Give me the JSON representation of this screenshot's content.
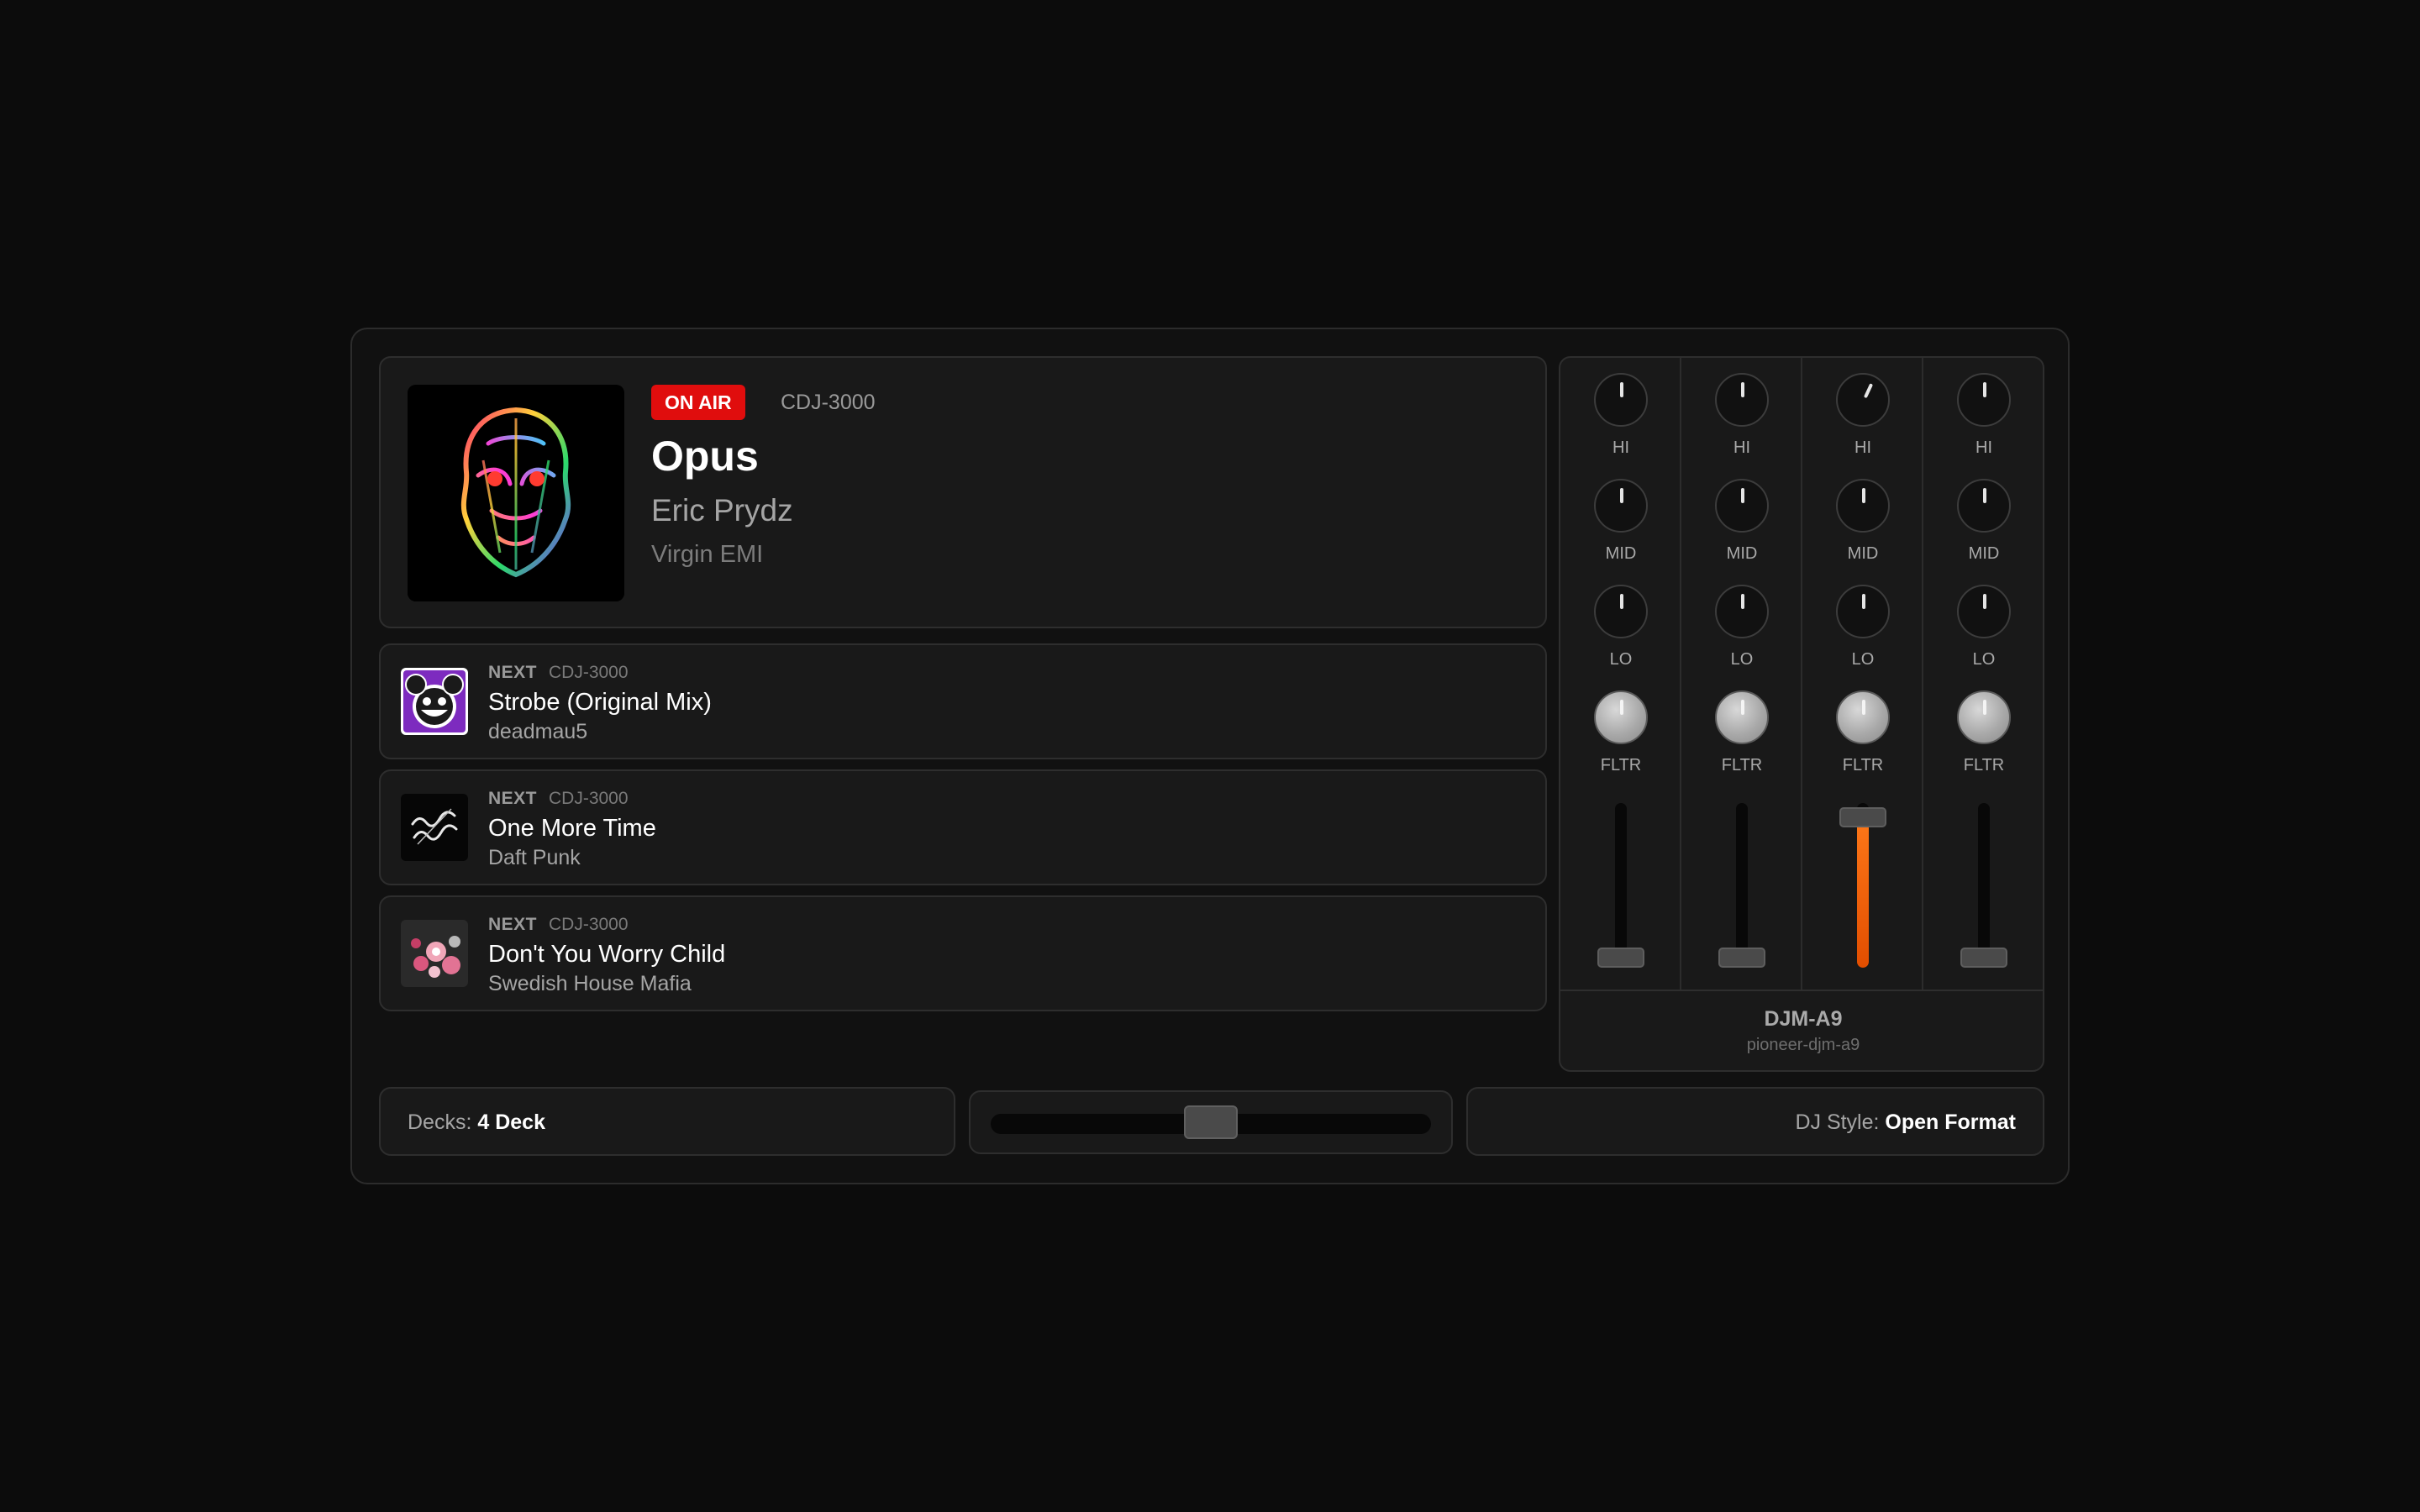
{
  "now_playing": {
    "badge": "ON AIR",
    "deck": "CDJ-3000",
    "title": "Opus",
    "artist": "Eric Prydz",
    "label": "Virgin EMI"
  },
  "queue": [
    {
      "tag": "NEXT",
      "deck": "CDJ-3000",
      "title": "Strobe (Original Mix)",
      "artist": "deadmau5"
    },
    {
      "tag": "NEXT",
      "deck": "CDJ-3000",
      "title": "One More Time",
      "artist": "Daft Punk"
    },
    {
      "tag": "NEXT",
      "deck": "CDJ-3000",
      "title": "Don't You Worry Child",
      "artist": "Swedish House Mafia"
    }
  ],
  "mixer": {
    "model": "DJM-A9",
    "id": "pioneer-djm-a9",
    "knob_labels": {
      "hi": "HI",
      "mid": "MID",
      "lo": "LO",
      "fltr": "FLTR"
    },
    "channels": [
      {
        "hi": 0,
        "mid": 0,
        "lo": 0,
        "fltr": 0,
        "fader": 0.0
      },
      {
        "hi": 0,
        "mid": 0,
        "lo": 0,
        "fltr": 0,
        "fader": 0.0
      },
      {
        "hi": 25,
        "mid": 0,
        "lo": 0,
        "fltr": 0,
        "fader": 0.97
      },
      {
        "hi": 0,
        "mid": 0,
        "lo": 0,
        "fltr": 0,
        "fader": 0.0
      }
    ]
  },
  "footer": {
    "decks_label": "Decks:",
    "decks_value": "4 Deck",
    "crossfader": 0.5,
    "style_label": "DJ Style:",
    "style_value": "Open Format"
  },
  "colors": {
    "on_air": "#e00d0d",
    "fader_active": "#ff7a1a",
    "background": "#0c0c0c"
  }
}
